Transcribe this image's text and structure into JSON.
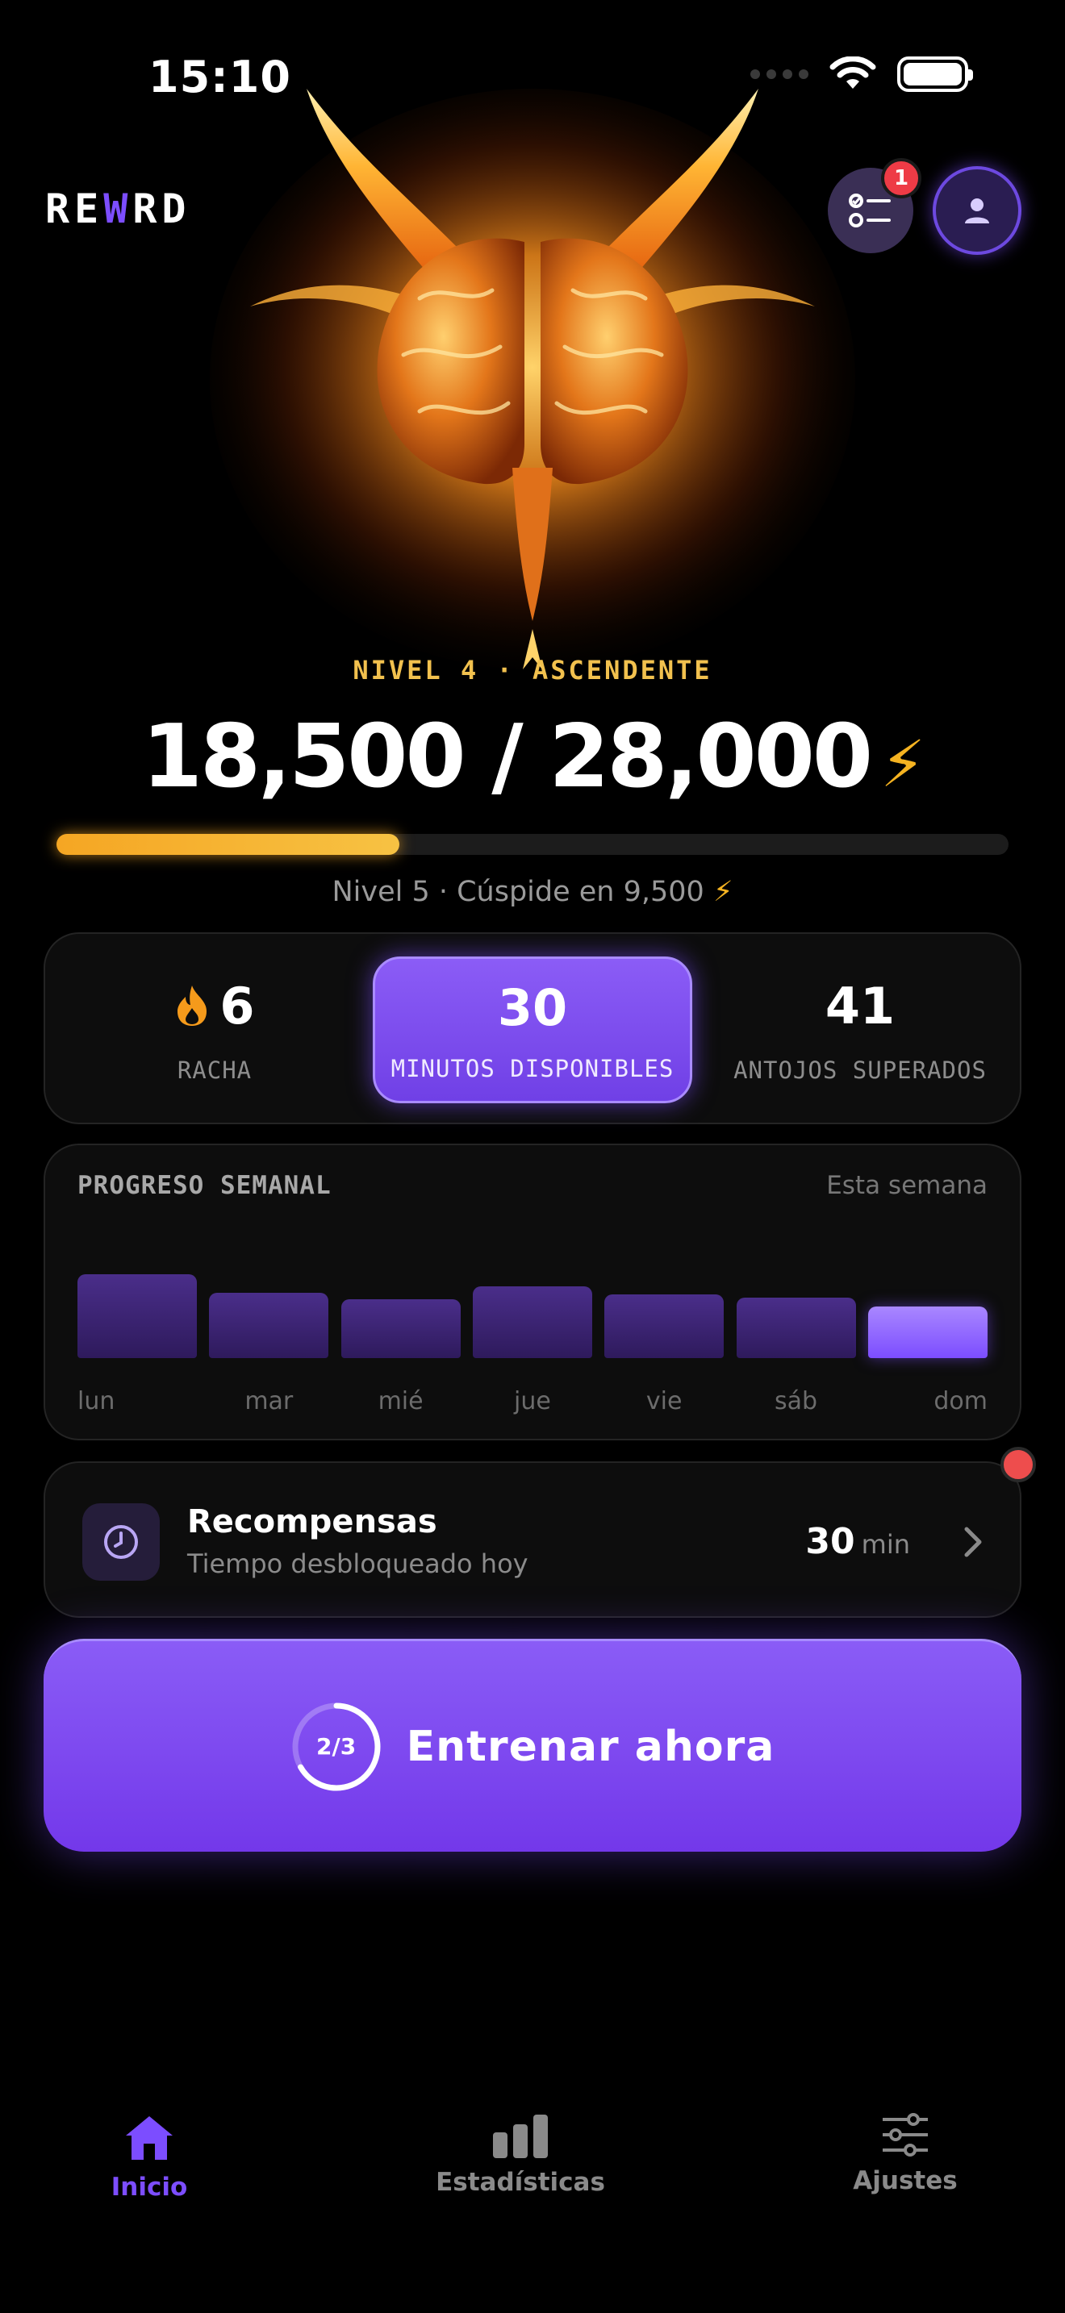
{
  "status_bar": {
    "time": "15:10"
  },
  "header": {
    "logo_prefix": "RE",
    "logo_accent": "W",
    "logo_suffix": "RD",
    "tasks_badge": "1"
  },
  "hero": {
    "level_label": "NIVEL 4 · ASCENDENTE",
    "xp_text": "18,500 / 28,000",
    "bolt": "⚡",
    "progress_fraction": 0.36,
    "next_level_text": "Nivel 5 · Cúspide en 9,500"
  },
  "stats": {
    "streak_value": "6",
    "streak_label": "RACHA",
    "minutes_value": "30",
    "minutes_label": "MINUTOS DISPONIBLES",
    "cravings_value": "41",
    "cravings_label": "ANTOJOS SUPERADOS"
  },
  "weekly": {
    "title": "PROGRESO SEMANAL",
    "subtitle": "Esta semana",
    "days": [
      "lun",
      "mar",
      "mié",
      "jue",
      "vie",
      "sáb",
      "dom"
    ],
    "levels": [
      1.0,
      0.78,
      0.7,
      0.86,
      0.76,
      0.72,
      0.62
    ],
    "active_index": 6
  },
  "rewards": {
    "title": "Recompensas",
    "subtitle": "Tiempo desbloqueado hoy",
    "value": "30",
    "unit": "min"
  },
  "cta": {
    "progress_text": "2/3",
    "progress_fraction": 0.667,
    "label": "Entrenar ahora"
  },
  "nav": {
    "home": "Inicio",
    "stats": "Estadísticas",
    "settings": "Ajustes"
  },
  "colors": {
    "accent": "#7c4dff",
    "gold": "#f5a623",
    "badge": "#ee3b46"
  }
}
